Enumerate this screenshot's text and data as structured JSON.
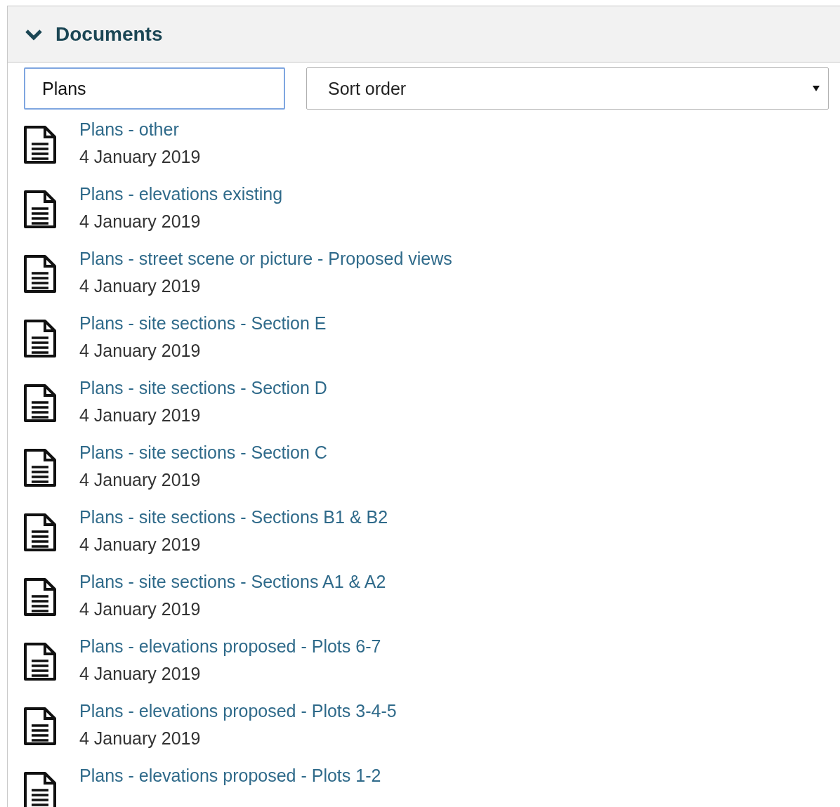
{
  "panel": {
    "title": "Documents",
    "expanded": true
  },
  "search": {
    "value": "Plans"
  },
  "sort": {
    "placeholder": "Sort order"
  },
  "documents": [
    {
      "title": "Plans - other",
      "date": "4 January 2019"
    },
    {
      "title": "Plans - elevations existing",
      "date": "4 January 2019"
    },
    {
      "title": "Plans - street scene or picture - Proposed views",
      "date": "4 January 2019"
    },
    {
      "title": "Plans - site sections - Section E",
      "date": "4 January 2019"
    },
    {
      "title": "Plans - site sections - Section D",
      "date": "4 January 2019"
    },
    {
      "title": "Plans - site sections - Section C",
      "date": "4 January 2019"
    },
    {
      "title": "Plans - site sections - Sections B1 & B2",
      "date": "4 January 2019"
    },
    {
      "title": "Plans - site sections - Sections A1 & A2",
      "date": "4 January 2019"
    },
    {
      "title": "Plans - elevations proposed - Plots 6-7",
      "date": "4 January 2019"
    },
    {
      "title": "Plans - elevations proposed - Plots 3-4-5",
      "date": "4 January 2019"
    },
    {
      "title": "Plans - elevations proposed - Plots 1-2"
    }
  ]
}
